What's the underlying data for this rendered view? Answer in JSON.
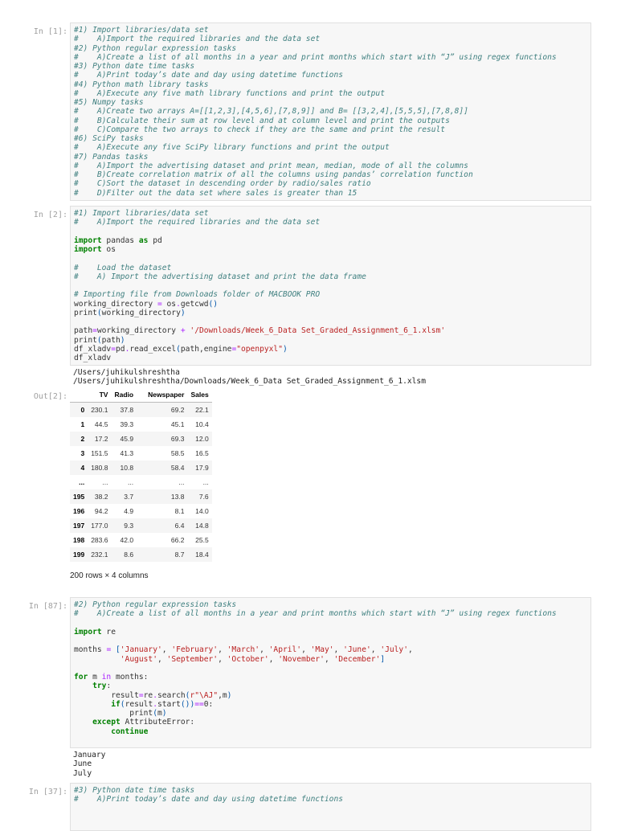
{
  "cells": [
    {
      "prompt": "In [1]:",
      "lines": [
        [
          [
            "c",
            "#1) Import libraries/data set"
          ]
        ],
        [
          [
            "c",
            "#    A)Import the required libraries and the data set"
          ]
        ],
        [
          [
            "c",
            "#2) Python regular expression tasks"
          ]
        ],
        [
          [
            "c",
            "#    A)Create a list of all months in a year and print months which start with “J” using regex functions"
          ]
        ],
        [
          [
            "c",
            "#3) Python date time tasks"
          ]
        ],
        [
          [
            "c",
            "#    A)Print today’s date and day using datetime functions"
          ]
        ],
        [
          [
            "c",
            "#4) Python math library tasks"
          ]
        ],
        [
          [
            "c",
            "#    A)Execute any five math library functions and print the output"
          ]
        ],
        [
          [
            "c",
            "#5) Numpy tasks"
          ]
        ],
        [
          [
            "c",
            "#    A)Create two arrays A=[[1,2,3],[4,5,6],[7,8,9]] and B= [[3,2,4],[5,5,5],[7,8,8]]"
          ]
        ],
        [
          [
            "c",
            "#    B)Calculate their sum at row level and at column level and print the outputs"
          ]
        ],
        [
          [
            "c",
            "#    C)Compare the two arrays to check if they are the same and print the result"
          ]
        ],
        [
          [
            "c",
            "#6) SciPy tasks"
          ]
        ],
        [
          [
            "c",
            "#    A)Execute any five SciPy library functions and print the output"
          ]
        ],
        [
          [
            "c",
            "#7) Pandas tasks"
          ]
        ],
        [
          [
            "c",
            "#    A)Import the advertising dataset and print mean, median, mode of all the columns"
          ]
        ],
        [
          [
            "c",
            "#    B)Create correlation matrix of all the columns using pandas’ correlation function"
          ]
        ],
        [
          [
            "c",
            "#    C)Sort the dataset in descending order by radio/sales ratio"
          ]
        ],
        [
          [
            "c",
            "#    D)Filter out the data set where sales is greater than 15"
          ]
        ]
      ]
    },
    {
      "prompt": "In [2]:",
      "lines": [
        [
          [
            "c",
            "#1) Import libraries/data set"
          ]
        ],
        [
          [
            "c",
            "#    A)Import the required libraries and the data set"
          ]
        ],
        [],
        [
          [
            "k",
            "import"
          ],
          [
            "n",
            " pandas "
          ],
          [
            "k",
            "as"
          ],
          [
            "n",
            " pd"
          ]
        ],
        [
          [
            "k",
            "import"
          ],
          [
            "n",
            " os"
          ]
        ],
        [],
        [
          [
            "c",
            "#    Load the dataset"
          ]
        ],
        [
          [
            "c",
            "#    A) Import the advertising dataset and print the data frame"
          ]
        ],
        [],
        [
          [
            "c",
            "# Importing file from Downloads folder of MACBOOK PRO"
          ]
        ],
        [
          [
            "n",
            "working_directory "
          ],
          [
            "o",
            "="
          ],
          [
            "n",
            " os"
          ],
          [
            "o",
            "."
          ],
          [
            "n",
            "getcwd"
          ],
          [
            "p",
            "()"
          ]
        ],
        [
          [
            "n",
            "print"
          ],
          [
            "p",
            "("
          ],
          [
            "n",
            "working_directory"
          ],
          [
            "p",
            ")"
          ]
        ],
        [],
        [
          [
            "n",
            "path"
          ],
          [
            "o",
            "="
          ],
          [
            "n",
            "working_directory "
          ],
          [
            "o",
            "+"
          ],
          [
            "n",
            " "
          ],
          [
            "s",
            "'/Downloads/Week_6_Data Set_Graded_Assignment_6_1.xlsm'"
          ]
        ],
        [
          [
            "n",
            "print"
          ],
          [
            "p",
            "("
          ],
          [
            "n",
            "path"
          ],
          [
            "p",
            ")"
          ]
        ],
        [
          [
            "n",
            "df_xladv"
          ],
          [
            "o",
            "="
          ],
          [
            "n",
            "pd"
          ],
          [
            "o",
            "."
          ],
          [
            "n",
            "read_excel"
          ],
          [
            "p",
            "("
          ],
          [
            "n",
            "path,engine"
          ],
          [
            "o",
            "="
          ],
          [
            "s",
            "\"openpyxl\""
          ],
          [
            "p",
            ")"
          ]
        ],
        [
          [
            "n",
            "df_xladv"
          ]
        ]
      ],
      "stdout": "/Users/juhikulshreshtha\n/Users/juhikulshreshtha/Downloads/Week_6_Data Set_Graded_Assignment_6_1.xlsm",
      "out_prompt": "Out[2]:",
      "table": {
        "columns": [
          "",
          "TV",
          "Radio",
          "Newspaper",
          "Sales"
        ],
        "rows": [
          [
            "0",
            "230.1",
            "37.8",
            "69.2",
            "22.1"
          ],
          [
            "1",
            "44.5",
            "39.3",
            "45.1",
            "10.4"
          ],
          [
            "2",
            "17.2",
            "45.9",
            "69.3",
            "12.0"
          ],
          [
            "3",
            "151.5",
            "41.3",
            "58.5",
            "16.5"
          ],
          [
            "4",
            "180.8",
            "10.8",
            "58.4",
            "17.9"
          ],
          [
            "...",
            "...",
            "...",
            "...",
            "..."
          ],
          [
            "195",
            "38.2",
            "3.7",
            "13.8",
            "7.6"
          ],
          [
            "196",
            "94.2",
            "4.9",
            "8.1",
            "14.0"
          ],
          [
            "197",
            "177.0",
            "9.3",
            "6.4",
            "14.8"
          ],
          [
            "198",
            "283.6",
            "42.0",
            "66.2",
            "25.5"
          ],
          [
            "199",
            "232.1",
            "8.6",
            "8.7",
            "18.4"
          ]
        ]
      },
      "shape": "200 rows × 4 columns"
    },
    {
      "prompt": "In [87]:",
      "lines": [
        [
          [
            "c",
            "#2) Python regular expression tasks"
          ]
        ],
        [
          [
            "c",
            "#    A)Create a list of all months in a year and print months which start with “J” using regex functions"
          ]
        ],
        [],
        [
          [
            "k",
            "import"
          ],
          [
            "n",
            " re"
          ]
        ],
        [],
        [
          [
            "n",
            "months "
          ],
          [
            "o",
            "="
          ],
          [
            "n",
            " "
          ],
          [
            "p",
            "["
          ],
          [
            "s",
            "'January'"
          ],
          [
            "n",
            ", "
          ],
          [
            "s",
            "'February'"
          ],
          [
            "n",
            ", "
          ],
          [
            "s",
            "'March'"
          ],
          [
            "n",
            ", "
          ],
          [
            "s",
            "'April'"
          ],
          [
            "n",
            ", "
          ],
          [
            "s",
            "'May'"
          ],
          [
            "n",
            ", "
          ],
          [
            "s",
            "'June'"
          ],
          [
            "n",
            ", "
          ],
          [
            "s",
            "'July'"
          ],
          [
            "n",
            ","
          ]
        ],
        [
          [
            "n",
            "          "
          ],
          [
            "s",
            "'August'"
          ],
          [
            "n",
            ", "
          ],
          [
            "s",
            "'September'"
          ],
          [
            "n",
            ", "
          ],
          [
            "s",
            "'October'"
          ],
          [
            "n",
            ", "
          ],
          [
            "s",
            "'November'"
          ],
          [
            "n",
            ", "
          ],
          [
            "s",
            "'December'"
          ],
          [
            "p",
            "]"
          ]
        ],
        [],
        [
          [
            "k",
            "for"
          ],
          [
            "n",
            " m "
          ],
          [
            "o",
            "in"
          ],
          [
            "n",
            " months:"
          ]
        ],
        [
          [
            "n",
            "    "
          ],
          [
            "k",
            "try"
          ],
          [
            "n",
            ":"
          ]
        ],
        [
          [
            "n",
            "        result"
          ],
          [
            "o",
            "="
          ],
          [
            "n",
            "re"
          ],
          [
            "o",
            "."
          ],
          [
            "n",
            "search"
          ],
          [
            "p",
            "("
          ],
          [
            "s",
            "r\"\\AJ\""
          ],
          [
            "n",
            ",m"
          ],
          [
            "p",
            ")"
          ]
        ],
        [
          [
            "n",
            "        "
          ],
          [
            "k",
            "if"
          ],
          [
            "p",
            "("
          ],
          [
            "n",
            "result"
          ],
          [
            "o",
            "."
          ],
          [
            "n",
            "start"
          ],
          [
            "p",
            "())"
          ],
          [
            "o",
            "=="
          ],
          [
            "n",
            "0:"
          ]
        ],
        [
          [
            "n",
            "            print"
          ],
          [
            "p",
            "("
          ],
          [
            "n",
            "m"
          ],
          [
            "p",
            ")"
          ]
        ],
        [
          [
            "n",
            "    "
          ],
          [
            "k",
            "except"
          ],
          [
            "n",
            " AttributeError:"
          ]
        ],
        [
          [
            "n",
            "        "
          ],
          [
            "k",
            "continue"
          ]
        ],
        []
      ],
      "stdout": "January\nJune\nJuly"
    },
    {
      "prompt": "In [37]:",
      "lines": [
        [
          [
            "c",
            "#3) Python date time tasks"
          ]
        ],
        [
          [
            "c",
            "#    A)Print today’s date and day using datetime functions"
          ]
        ],
        [],
        []
      ]
    }
  ]
}
